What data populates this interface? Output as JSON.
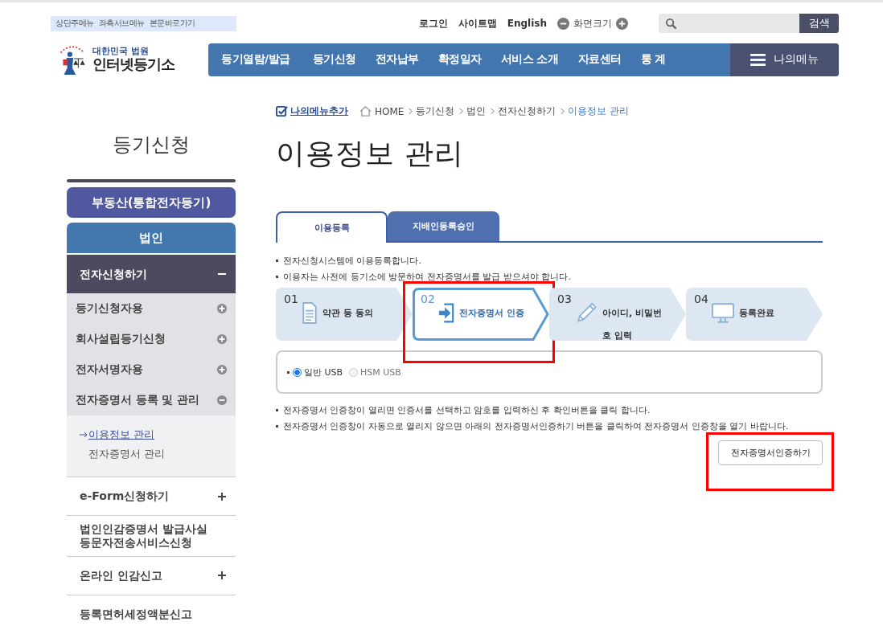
{
  "skip_links": [
    "상단주메뉴",
    "좌측서브메뉴",
    "본문바로가기"
  ],
  "utility_links": [
    "로그인",
    "사이트맵",
    "English"
  ],
  "font_size_label": "화면크기",
  "search": {
    "button": "검색"
  },
  "logo": {
    "line1": "대한민국 법원",
    "line2": "인터넷등기소"
  },
  "nav": {
    "items": [
      "등기열람/발급",
      "등기신청",
      "전자납부",
      "확정일자",
      "서비스 소개",
      "자료센터",
      "통 계"
    ],
    "my_menu": "나의메뉴"
  },
  "sidebar": {
    "title": "등기신청",
    "top_buttons": [
      {
        "label": "부동산(통합전자등기)",
        "selected": false
      },
      {
        "label": "법인",
        "selected": true
      }
    ],
    "items": [
      {
        "label": "전자신청하기",
        "expanded": true,
        "children": [
          {
            "label": "등기신청자용",
            "expanded": false
          },
          {
            "label": "회사설립등기신청",
            "expanded": false
          },
          {
            "label": "전자서명자용",
            "expanded": false
          },
          {
            "label": "전자증명서 등록 및 관리",
            "expanded": true,
            "children": [
              {
                "label": "이용정보 관리",
                "selected": true
              },
              {
                "label": "전자증명서 관리",
                "selected": false
              }
            ]
          }
        ]
      },
      {
        "label": "e-Form신청하기",
        "expanded": false
      },
      {
        "label": "법인인감증명서 발급사실\n등문자전송서비스신청"
      },
      {
        "label": "온라인 인감신고",
        "expanded": false
      },
      {
        "label": "등록면허세정액분신고"
      }
    ]
  },
  "breadcrumb": {
    "add_menu": "나의메뉴추가",
    "items": [
      {
        "label": "HOME",
        "current": false
      },
      {
        "label": "등기신청",
        "current": false
      },
      {
        "label": "법인",
        "current": false
      },
      {
        "label": "전자신청하기",
        "current": false
      },
      {
        "label": "이용정보 관리",
        "current": true
      }
    ]
  },
  "page_title": "이용정보 관리",
  "tabs": [
    {
      "label": "이용등록",
      "selected": true
    },
    {
      "label": "지배인등록승인",
      "selected": false
    }
  ],
  "intro_notes": [
    "전자신청시스템에 이용등록합니다.",
    "이용자는 사전에 등기소에 방문하여 전자증명서를 발급 받으셔야 합니다."
  ],
  "steps": [
    {
      "number": "01",
      "label": "약관 등 동의",
      "selected": false,
      "highlighted": false
    },
    {
      "number": "02",
      "label": "전자증명서 인증",
      "selected": true,
      "highlighted": true
    },
    {
      "number": "03",
      "label": "아이디, 비밀번호 입력",
      "selected": false,
      "highlighted": false
    },
    {
      "number": "04",
      "label": "등록완료",
      "selected": false,
      "highlighted": false
    }
  ],
  "usb_options": [
    {
      "label": "일반 USB",
      "selected": true
    },
    {
      "label": "HSM USB",
      "selected": false
    }
  ],
  "notes": [
    "전자증명서 인증창이 열리면 인증서를 선택하고 암호를 입력하신 후 확인버튼을 클릭 합니다.",
    "전자증명서 인증창이 자동으로 열리지 않으면 아래의 전자증명서인증하기 버튼을 클릭하여 전자증명서 인증창을 열기 바랍니다."
  ],
  "cert_button": {
    "label": "전자증명서인증하기",
    "highlighted": true
  }
}
